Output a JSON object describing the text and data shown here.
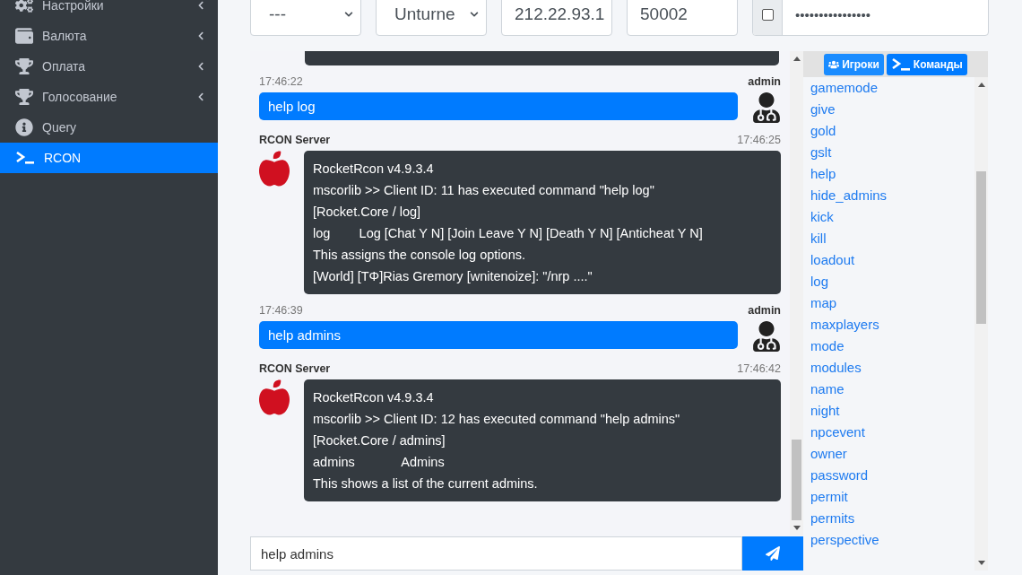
{
  "sidebar": {
    "items": [
      {
        "label": "Настройки",
        "has_submenu": true,
        "selected": false
      },
      {
        "label": "Валюта",
        "has_submenu": true,
        "selected": false
      },
      {
        "label": "Оплата",
        "has_submenu": true,
        "selected": false
      },
      {
        "label": "Голосование",
        "has_submenu": true,
        "selected": false
      },
      {
        "label": "Query",
        "has_submenu": false,
        "selected": false
      },
      {
        "label": "RCON",
        "has_submenu": false,
        "selected": true
      }
    ]
  },
  "connection": {
    "profile": "---",
    "game": "Unturne",
    "host": "212.22.93.1",
    "port": "50002",
    "show_password": false,
    "password": "••••••••••••••••"
  },
  "chat": {
    "messages": [
      {
        "kind": "outgoing",
        "author": "admin",
        "time": "17:46:22",
        "lines": [
          "help log"
        ]
      },
      {
        "kind": "incoming",
        "author": "RCON Server",
        "time": "17:46:25",
        "lines": [
          "RocketRcon v4.9.3.4",
          "mscorlib >> Client ID: 11 has executed command \"help log\"",
          "[Rocket.Core / log]",
          "log        Log [Chat Y N] [Join Leave Y N] [Death Y N] [Anticheat Y N]",
          "This assigns the console log options.",
          "[World] [TΦ]Rias Gremory [wnitenoize]: \"/nrp ....\""
        ]
      },
      {
        "kind": "outgoing",
        "author": "admin",
        "time": "17:46:39",
        "lines": [
          "help admins"
        ]
      },
      {
        "kind": "incoming",
        "author": "RCON Server",
        "time": "17:46:42",
        "lines": [
          "RocketRcon v4.9.3.4",
          "mscorlib >> Client ID: 12 has executed command \"help admins\"",
          "[Rocket.Core / admins]",
          "admins             Admins",
          "This shows a list of the current admins."
        ]
      }
    ],
    "input_value": "help admins"
  },
  "commands_panel": {
    "tabs": [
      {
        "label": "Игроки",
        "selected": false
      },
      {
        "label": "Команды",
        "selected": true
      }
    ],
    "commands": [
      "gamemode",
      "give",
      "gold",
      "gslt",
      "help",
      "hide_admins",
      "kick",
      "kill",
      "loadout",
      "log",
      "map",
      "maxplayers",
      "mode",
      "modules",
      "name",
      "night",
      "npcevent",
      "owner",
      "password",
      "permit",
      "permits",
      "perspective"
    ]
  }
}
